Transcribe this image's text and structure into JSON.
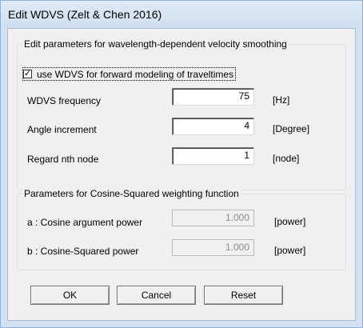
{
  "window": {
    "title": "Edit WDVS (Zelt & Chen 2016)"
  },
  "wdvs_group": {
    "title": "Edit parameters for wavelength-dependent velocity smoothing",
    "checkbox_label": "use WDVS for forward modeling of traveltimes",
    "checkbox_checked": true,
    "checkbox_glyph": "✓",
    "fields": [
      {
        "label": "WDVS frequency",
        "value": "75",
        "unit": "[Hz]"
      },
      {
        "label": "Angle increment",
        "value": "4",
        "unit": "[Degree]"
      },
      {
        "label": "Regard nth node",
        "value": "1",
        "unit": "[node]"
      }
    ]
  },
  "cosine_group": {
    "title": "Parameters for Cosine-Squared weighting function",
    "fields": [
      {
        "label": "a : Cosine argument power",
        "value": "1.000",
        "unit": "[power]"
      },
      {
        "label": "b : Cosine-Squared power",
        "value": "1.000",
        "unit": "[power]"
      }
    ]
  },
  "buttons": {
    "ok": "OK",
    "cancel": "Cancel",
    "reset": "Reset"
  }
}
